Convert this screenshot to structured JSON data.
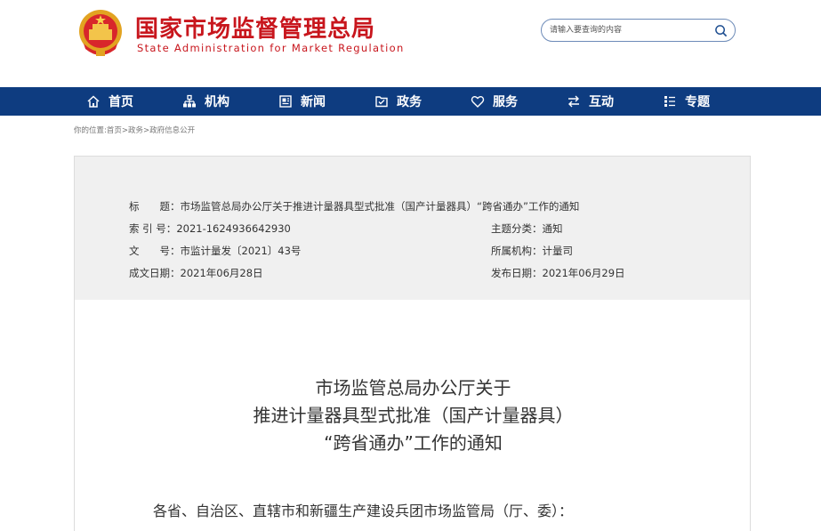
{
  "header": {
    "title": "国家市场监督管理总局",
    "subtitle": "State Administration for Market Regulation",
    "title_color": "#c8161d",
    "logo_name": "national-emblem"
  },
  "search": {
    "placeholder": "请输入要查询的内容",
    "icon": "search-icon"
  },
  "nav": {
    "background": "#0e3c80",
    "items": [
      {
        "label": "首页",
        "icon": "home-icon"
      },
      {
        "label": "机构",
        "icon": "org-chart-icon"
      },
      {
        "label": "新闻",
        "icon": "newspaper-icon"
      },
      {
        "label": "政务",
        "icon": "folder-icon"
      },
      {
        "label": "服务",
        "icon": "heart-icon"
      },
      {
        "label": "互动",
        "icon": "exchange-icon"
      },
      {
        "label": "专题",
        "icon": "grid-icon"
      }
    ]
  },
  "breadcrumb": {
    "prefix": "你的位置:",
    "items": [
      "首页",
      "政务",
      "政府信息公开"
    ],
    "separator": ">"
  },
  "meta": {
    "title_key": "标　　题：",
    "title_value": "市场监管总局办公厅关于推进计量器具型式批准（国产计量器具）“跨省通办”工作的通知",
    "index_key": "索 引 号：",
    "index_value": "2021-1624936642930",
    "category_key": "主题分类：",
    "category_value": "通知",
    "docno_key": "文　　号：",
    "docno_value": "市监计量发〔2021〕43号",
    "org_key": "所属机构：",
    "org_value": "计量司",
    "created_key": "成文日期：",
    "created_value": "2021年06月28日",
    "published_key": "发布日期：",
    "published_value": "2021年06月29日"
  },
  "document": {
    "title_lines": [
      "市场监管总局办公厅关于",
      "推进计量器具型式批准（国产计量器具）",
      "“跨省通办”工作的通知"
    ],
    "salutation": "各省、自治区、直辖市和新疆生产建设兵团市场监管局（厅、委）："
  }
}
